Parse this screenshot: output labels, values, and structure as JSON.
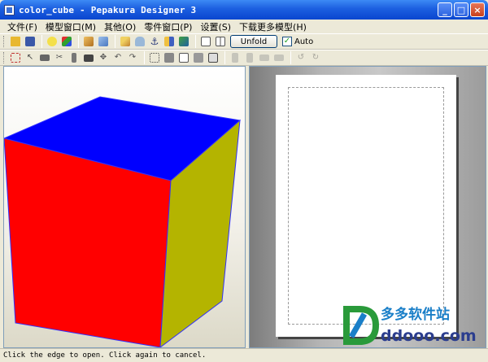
{
  "window": {
    "title": "color_cube - Pepakura Designer 3",
    "controls": [
      "_",
      "□",
      "×"
    ]
  },
  "menu": [
    "文件(F)",
    "模型窗口(M)",
    "其他(O)",
    "零件窗口(P)",
    "设置(S)",
    "下载更多模型(H)"
  ],
  "toolbar": {
    "unfold_label": "Unfold",
    "auto_label": "Auto",
    "auto_checked": "✓"
  },
  "icons": {
    "toolbar1": [
      "open-folder-icon",
      "save-icon",
      "lightbulb-icon",
      "texture-cube-icon",
      "shaded-cube-icon",
      "unshaded-cube-icon",
      "pencil-icon",
      "cylinder-icon",
      "anchor-icon",
      "flap-icon",
      "layout-icon",
      "window-single-icon",
      "window-double-icon"
    ],
    "toolbar2": [
      "select-icon",
      "edit-icon",
      "join-icon",
      "cut-icon",
      "glue-icon",
      "rotate-icon",
      "move-icon",
      "undo-icon",
      "redo-icon",
      "fit-icon",
      "arrange-icon",
      "page-icon",
      "print-icon",
      "zoom-icon"
    ]
  },
  "cube_colors": {
    "top": "#0000ff",
    "front": "#ff0000",
    "side": "#b4b400",
    "edge": "#3030ff"
  },
  "status": {
    "message": "Click the edge to open. Click again to cancel."
  },
  "watermark": {
    "brand": "多多软件站",
    "url": "ddooo.com"
  }
}
